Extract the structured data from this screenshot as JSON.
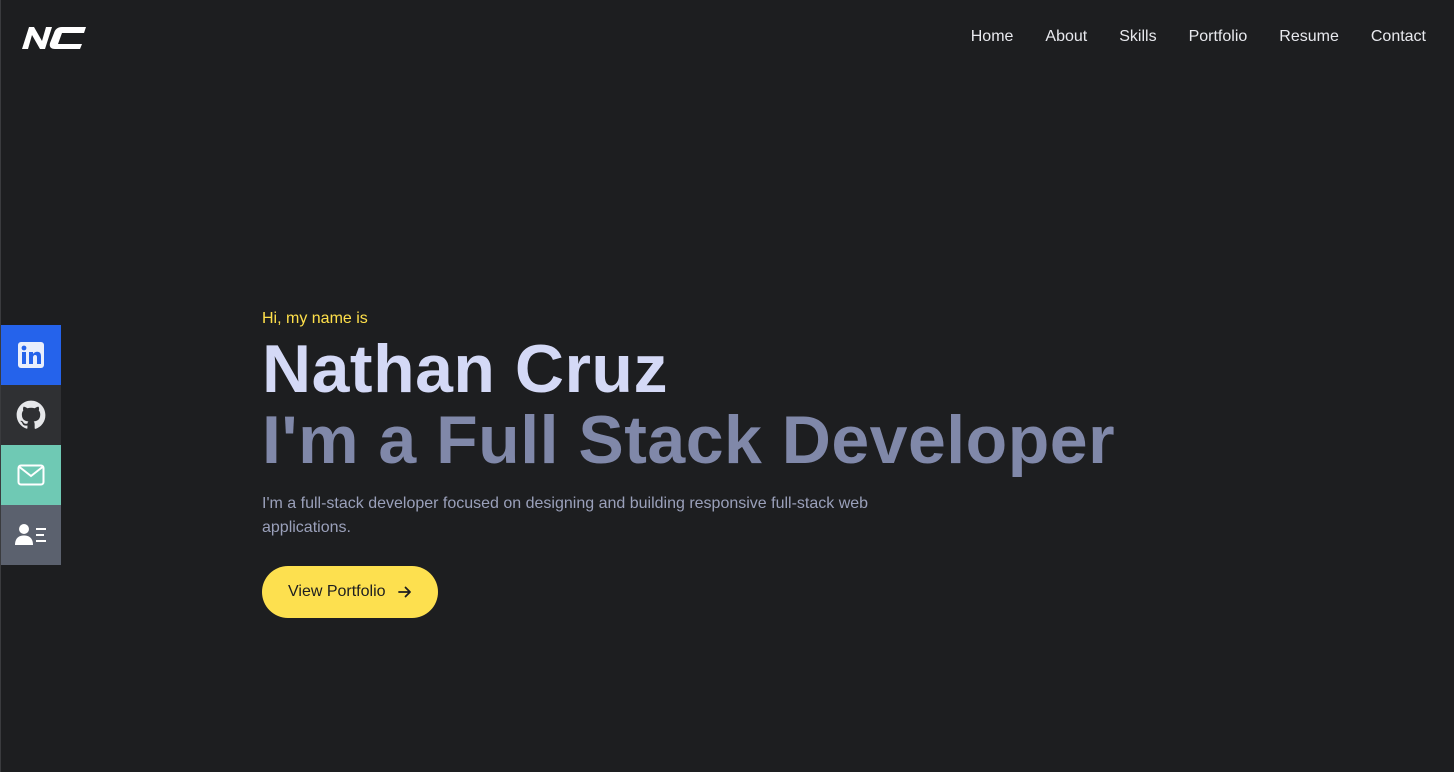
{
  "brand": {
    "logo_text": "NC"
  },
  "nav": {
    "items": [
      "Home",
      "About",
      "Skills",
      "Portfolio",
      "Resume",
      "Contact"
    ]
  },
  "social": [
    {
      "icon": "linkedin-icon",
      "color": "#2563eb"
    },
    {
      "icon": "github-icon",
      "color": "#2f3033"
    },
    {
      "icon": "mail-icon",
      "color": "#6fc9b4"
    },
    {
      "icon": "contact-card-icon",
      "color": "#5b616e"
    }
  ],
  "hero": {
    "greeting": "Hi, my name is",
    "name": "Nathan Cruz",
    "role": "I'm a Full Stack Developer",
    "description": "I'm a full-stack developer focused on designing and building responsive full-stack web applications.",
    "cta_label": "View Portfolio"
  },
  "colors": {
    "background": "#1d1e20",
    "accent": "#fde04f",
    "name": "#d4d9f6",
    "role": "#8088a9"
  }
}
